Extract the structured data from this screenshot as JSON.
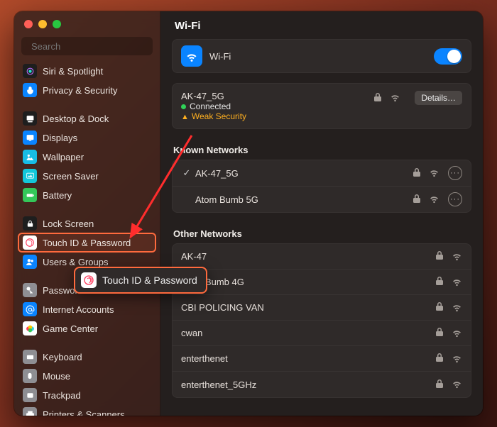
{
  "header": {
    "title": "Wi-Fi"
  },
  "search": {
    "placeholder": "Search"
  },
  "sidebar": {
    "groups": [
      [
        {
          "label": "Siri & Spotlight",
          "icon": "siri",
          "bg": "#1e1e1e"
        },
        {
          "label": "Privacy & Security",
          "icon": "hand",
          "bg": "#0a84ff"
        }
      ],
      [
        {
          "label": "Desktop & Dock",
          "icon": "dock",
          "bg": "#1e1e1e"
        },
        {
          "label": "Displays",
          "icon": "displays",
          "bg": "#0a84ff"
        },
        {
          "label": "Wallpaper",
          "icon": "wallpaper",
          "bg": "#17bce5"
        },
        {
          "label": "Screen Saver",
          "icon": "screensaver",
          "bg": "#13c7d9"
        },
        {
          "label": "Battery",
          "icon": "battery",
          "bg": "#34c759"
        }
      ],
      [
        {
          "label": "Lock Screen",
          "icon": "lock",
          "bg": "#1e1e1e"
        },
        {
          "label": "Touch ID & Password",
          "icon": "touchid",
          "bg": "#fff",
          "selected": true
        },
        {
          "label": "Users & Groups",
          "icon": "users",
          "bg": "#0a84ff"
        }
      ],
      [
        {
          "label": "Passwords",
          "icon": "key",
          "bg": "#8e8e93",
          "labelFirstChar": "P"
        },
        {
          "label": "Internet Accounts",
          "icon": "at",
          "bg": "#0a84ff"
        },
        {
          "label": "Game Center",
          "icon": "game",
          "bg": "#fff"
        }
      ],
      [
        {
          "label": "Keyboard",
          "icon": "keyboard",
          "bg": "#8e8e93"
        },
        {
          "label": "Mouse",
          "icon": "mouse",
          "bg": "#8e8e93"
        },
        {
          "label": "Trackpad",
          "icon": "trackpad",
          "bg": "#8e8e93"
        },
        {
          "label": "Printers & Scanners",
          "icon": "printer",
          "bg": "#8e8e93"
        }
      ]
    ]
  },
  "wifi": {
    "toggle_label": "Wi-Fi",
    "enabled": true,
    "current": {
      "ssid": "AK-47_5G",
      "status": "Connected",
      "warning": "Weak Security",
      "details_label": "Details…"
    },
    "known_header": "Known Networks",
    "known": [
      {
        "ssid": "AK-47_5G",
        "checked": true
      },
      {
        "ssid": "Atom Bumb 5G",
        "checked": false
      }
    ],
    "other_header": "Other Networks",
    "other": [
      {
        "ssid": "AK-47"
      },
      {
        "ssid": "Atom Bumb 4G"
      },
      {
        "ssid": "CBI POLICING VAN"
      },
      {
        "ssid": "cwan"
      },
      {
        "ssid": "enterthenet"
      },
      {
        "ssid": "enterthenet_5GHz"
      }
    ]
  },
  "callout": {
    "label": "Touch ID & Password"
  }
}
